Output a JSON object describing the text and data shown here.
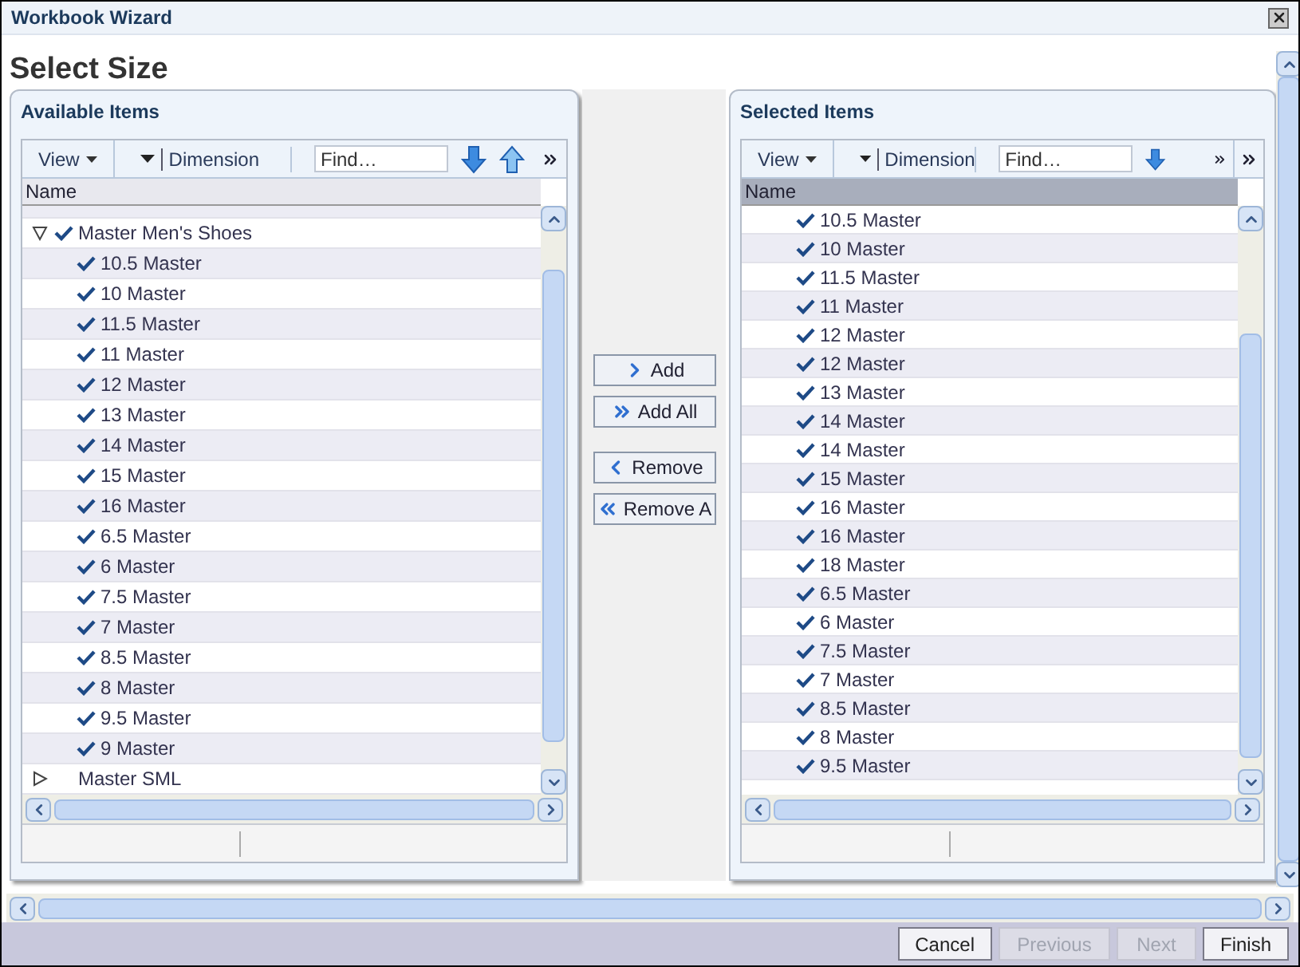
{
  "window": {
    "title": "Workbook Wizard"
  },
  "heading": "Select Size",
  "available": {
    "title": "Available Items",
    "toolbar": {
      "view": "View",
      "dimension": "Dimension",
      "find_placeholder": "Find…"
    },
    "column": "Name",
    "tree": [
      {
        "label": "Master Men's Shoes",
        "checked": true,
        "expanded": true,
        "children": [
          {
            "label": "10.5 Master",
            "checked": true
          },
          {
            "label": "10 Master",
            "checked": true
          },
          {
            "label": "11.5 Master",
            "checked": true
          },
          {
            "label": "11 Master",
            "checked": true
          },
          {
            "label": "12 Master",
            "checked": true
          },
          {
            "label": "13 Master",
            "checked": true
          },
          {
            "label": "14 Master",
            "checked": true
          },
          {
            "label": "15 Master",
            "checked": true
          },
          {
            "label": "16 Master",
            "checked": true
          },
          {
            "label": "6.5 Master",
            "checked": true
          },
          {
            "label": "6 Master",
            "checked": true
          },
          {
            "label": "7.5 Master",
            "checked": true
          },
          {
            "label": "7 Master",
            "checked": true
          },
          {
            "label": "8.5 Master",
            "checked": true
          },
          {
            "label": "8 Master",
            "checked": true
          },
          {
            "label": "9.5 Master",
            "checked": true
          },
          {
            "label": "9 Master",
            "checked": true
          }
        ]
      },
      {
        "label": "Master SML",
        "checked": false,
        "expanded": false
      }
    ]
  },
  "selected": {
    "title": "Selected Items",
    "toolbar": {
      "view": "View",
      "dimension": "Dimension",
      "find_placeholder": "Find…"
    },
    "column": "Name",
    "items": [
      {
        "label": "10.5 Master",
        "checked": true
      },
      {
        "label": "10 Master",
        "checked": true
      },
      {
        "label": "11.5 Master",
        "checked": true
      },
      {
        "label": "11 Master",
        "checked": true
      },
      {
        "label": "12 Master",
        "checked": true
      },
      {
        "label": "12 Master",
        "checked": true
      },
      {
        "label": "13 Master",
        "checked": true
      },
      {
        "label": "14 Master",
        "checked": true
      },
      {
        "label": "14 Master",
        "checked": true
      },
      {
        "label": "15 Master",
        "checked": true
      },
      {
        "label": "16 Master",
        "checked": true
      },
      {
        "label": "16 Master",
        "checked": true
      },
      {
        "label": "18 Master",
        "checked": true
      },
      {
        "label": "6.5 Master",
        "checked": true
      },
      {
        "label": "6 Master",
        "checked": true
      },
      {
        "label": "7.5 Master",
        "checked": true
      },
      {
        "label": "7 Master",
        "checked": true
      },
      {
        "label": "8.5 Master",
        "checked": true
      },
      {
        "label": "8 Master",
        "checked": true
      },
      {
        "label": "9.5 Master",
        "checked": true
      }
    ]
  },
  "transfer_buttons": [
    {
      "kind": "add",
      "label": "Add"
    },
    {
      "kind": "add_all",
      "label": "Add All"
    },
    {
      "kind": "remove",
      "label": "Remove"
    },
    {
      "kind": "remove_all",
      "label": "Remove A"
    }
  ],
  "footer_buttons": [
    {
      "label": "Cancel",
      "disabled": false
    },
    {
      "label": "Previous",
      "disabled": true
    },
    {
      "label": "Next",
      "disabled": true
    },
    {
      "label": "Finish",
      "disabled": false
    }
  ]
}
